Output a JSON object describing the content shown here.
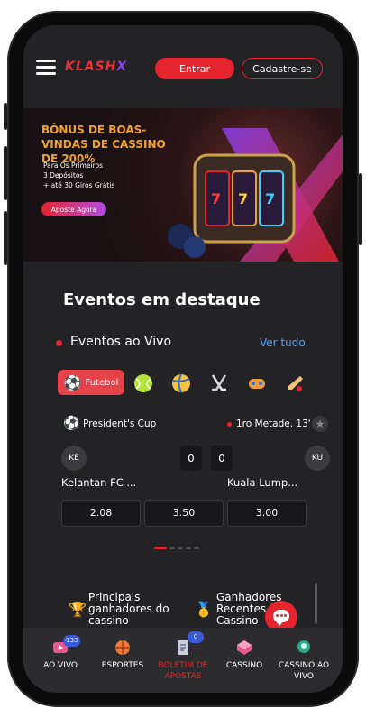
{
  "header": {
    "logo_main": "KLASH",
    "logo_x": "X",
    "login_label": "Entrar",
    "signup_label": "Cadastre-se"
  },
  "banner": {
    "title": "BÔNUS DE BOAS-VINDAS DE CASSINO DE 200%",
    "line1": "Para Os Primeiros",
    "line2": "3 Depósitos",
    "line3": "+ até 30 Giros Grátis",
    "cta": "Aposte Agora"
  },
  "featured": {
    "title": "Eventos em destaque"
  },
  "live": {
    "title": "Eventos ao Vivo",
    "see_all": "Ver tudo."
  },
  "sport_tabs": {
    "active_label": "Futebol",
    "items": [
      "soccer-ball-icon",
      "tennis-ball-icon",
      "volleyball-icon",
      "hockey-sticks-icon",
      "esports-icon",
      "cricket-icon"
    ]
  },
  "match": {
    "league": "President's Cup",
    "status": "1ro Metade. 13'",
    "home_abbr": "KE",
    "away_abbr": "KU",
    "home_score": "0",
    "away_score": "0",
    "home_name": "Kelantan FC ...",
    "away_name": "Kuala Lump...",
    "odds": [
      "2.08",
      "3.50",
      "3.00"
    ]
  },
  "winners": {
    "top_label_1": "Principais",
    "top_label_2": "ganhadores do",
    "top_label_3": "cassino",
    "recent_label_1": "Ganhadores",
    "recent_label_2": "Recentes",
    "recent_label_3": "Cassino"
  },
  "bottom_nav": {
    "live": "AO VIVO",
    "live_badge": "133",
    "sports": "ESPORTES",
    "betslip_1": "BOLETIM DE",
    "betslip_2": "APOSTAS",
    "betslip_badge": "0",
    "casino": "CASSINO",
    "live_casino_1": "CASSINO AO",
    "live_casino_2": "VIVO"
  },
  "colors": {
    "accent": "#e5242d",
    "link": "#4da3ff",
    "background": "#232325",
    "banner_gold": "#f2a227"
  }
}
